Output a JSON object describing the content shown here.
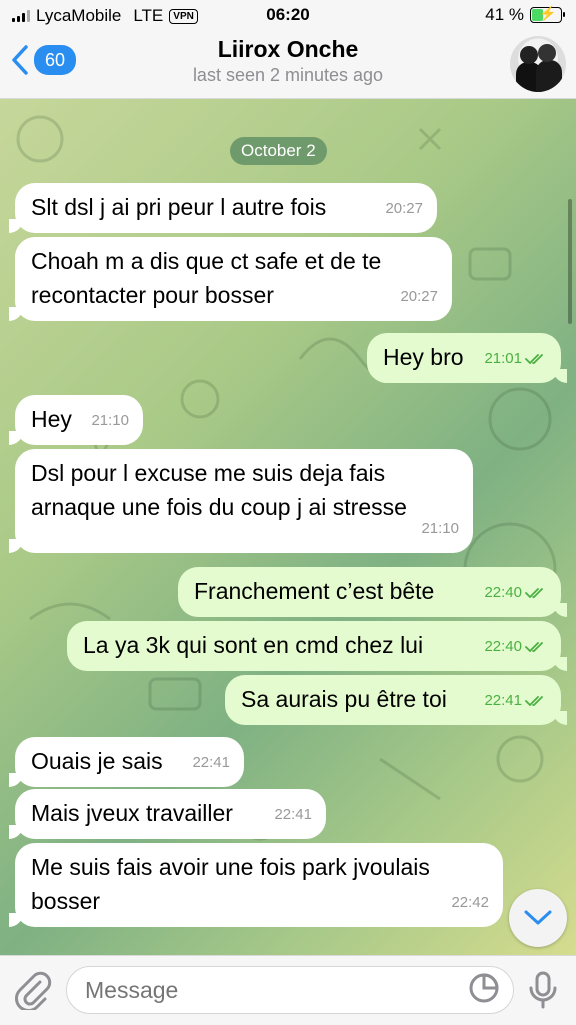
{
  "status": {
    "carrier": "LycaMobile",
    "network": "LTE",
    "vpn": "VPN",
    "time": "06:20",
    "battery": "41 %",
    "battery_level": 0.41
  },
  "header": {
    "unread_count": "60",
    "contact_name": "Liirox Onche",
    "last_seen": "last seen 2 minutes ago"
  },
  "chat": {
    "date": "October 2",
    "messages": [
      {
        "dir": "in",
        "text": "Slt dsl j ai pri peur l autre fois",
        "time": "20:27"
      },
      {
        "dir": "in",
        "text": "Choah m a dis que ct safe et de te\nrecontacter pour bosser",
        "time": "20:27"
      },
      {
        "dir": "out",
        "text": "Hey bro",
        "time": "21:01"
      },
      {
        "dir": "in",
        "text": "Hey",
        "time": "21:10"
      },
      {
        "dir": "in",
        "text": "Dsl pour l excuse me suis deja fais\narnaque une fois du coup j ai stresse",
        "time": "21:10"
      },
      {
        "dir": "out",
        "text": "Franchement c’est bête",
        "time": "22:40"
      },
      {
        "dir": "out",
        "text": "La ya 3k qui sont en cmd chez lui",
        "time": "22:40"
      },
      {
        "dir": "out",
        "text": "Sa aurais pu être toi",
        "time": "22:41"
      },
      {
        "dir": "in",
        "text": "Ouais je sais",
        "time": "22:41"
      },
      {
        "dir": "in",
        "text": "Mais jveux travailler",
        "time": "22:41"
      },
      {
        "dir": "in",
        "text": "Me suis fais avoir une fois park jvoulais\nbosser",
        "time": "22:42"
      }
    ]
  },
  "input": {
    "placeholder": "Message"
  },
  "colors": {
    "accent": "#2a8ef0",
    "outgoing_bubble": "#e4fbd0",
    "incoming_bubble": "#ffffff",
    "read_check": "#4bb042"
  }
}
